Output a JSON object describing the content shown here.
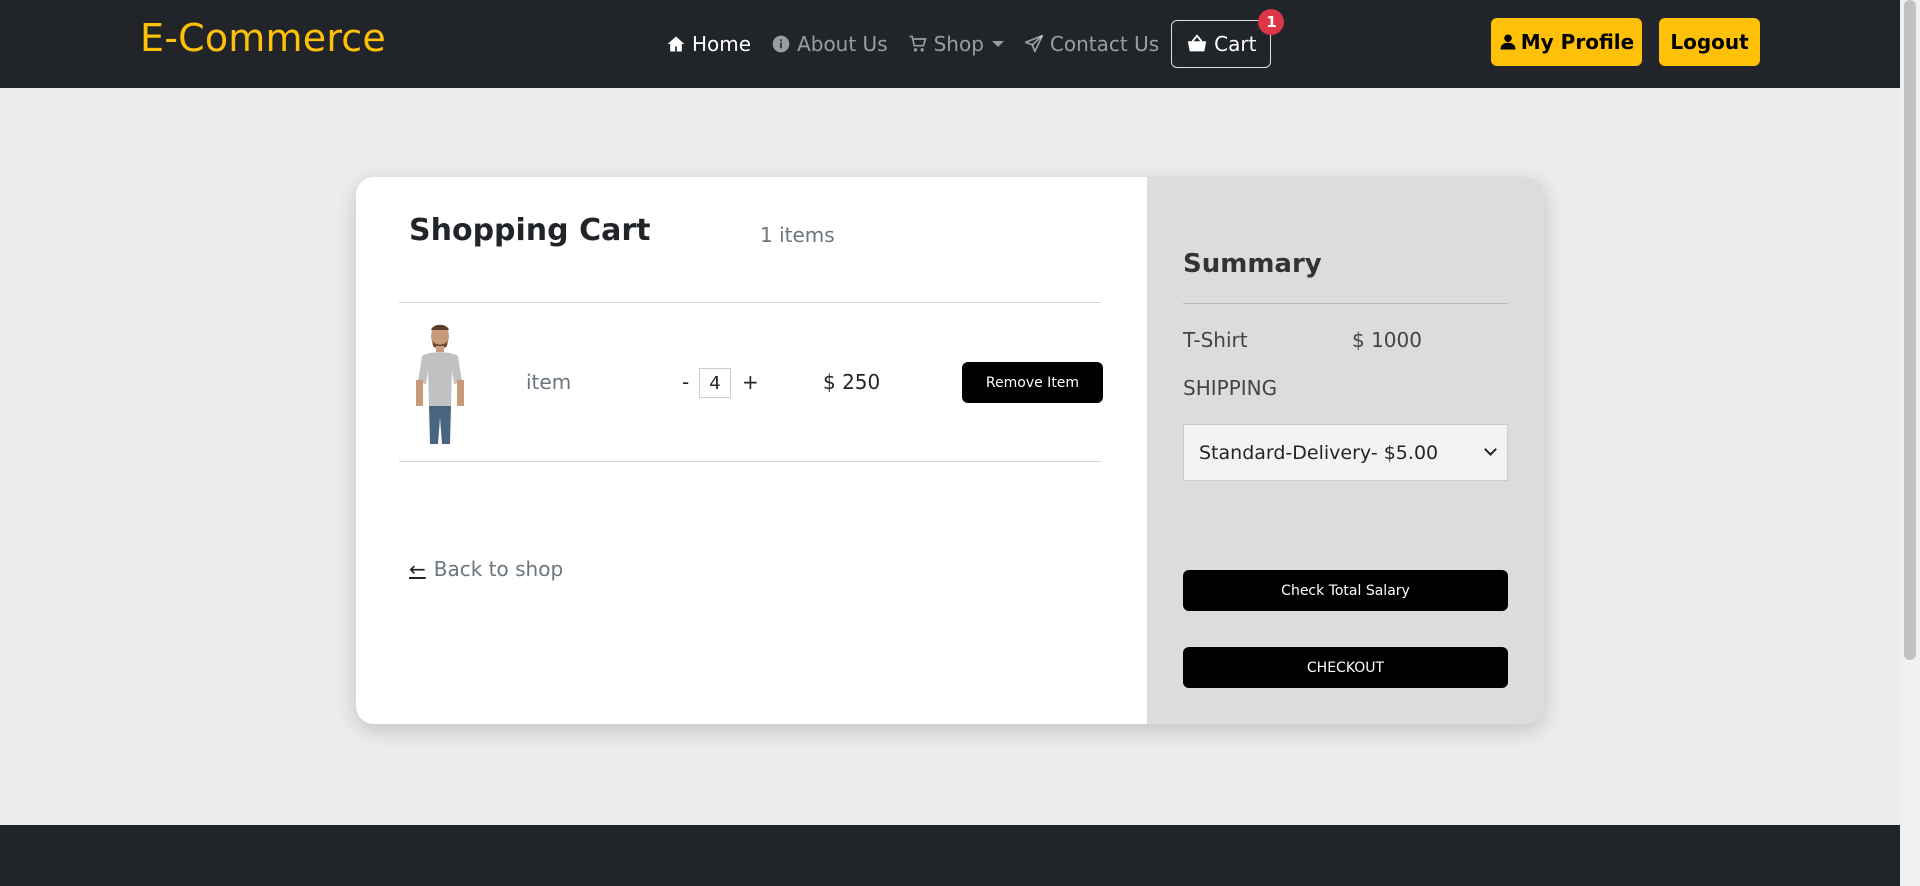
{
  "brand": "E-Commerce",
  "nav": {
    "home": "Home",
    "about": "About Us",
    "shop": "Shop",
    "contact": "Contact Us",
    "cart": "Cart",
    "cart_count": "1"
  },
  "header_buttons": {
    "profile": "My Profile",
    "logout": "Logout"
  },
  "cart": {
    "title": "Shopping Cart",
    "items_count": "1 items",
    "items": [
      {
        "name": "item",
        "quantity": "4",
        "price": "$ 250",
        "remove_label": "Remove Item",
        "minus": "-",
        "plus": "+"
      }
    ],
    "back_arrow": "←",
    "back_label": "Back to shop"
  },
  "summary": {
    "title": "Summary",
    "line_item_name": "T-Shirt",
    "line_item_value": "$ 1000",
    "shipping_label": "SHIPPING",
    "shipping_selected": "Standard-Delivery- $5.00",
    "salary_button": "Check Total Salary",
    "checkout_button": "CHECKOUT"
  },
  "colors": {
    "brand": "#ffc107",
    "navbar": "#212529",
    "badge": "#dc3545"
  }
}
